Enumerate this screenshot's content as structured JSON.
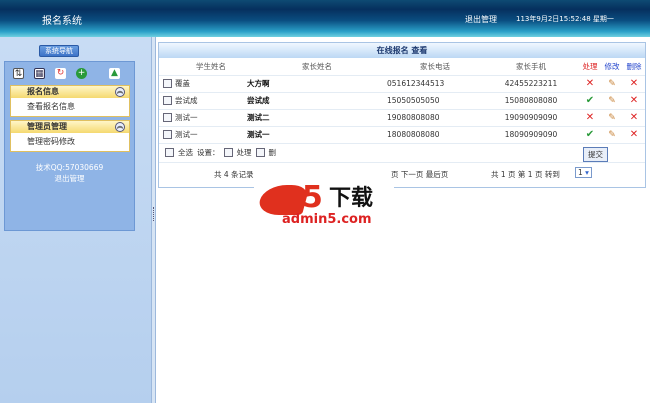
{
  "header": {
    "title": "报名系统",
    "logout": "退出管理",
    "datetime": "113年9月2日15:52:48 星期一"
  },
  "sidebar": {
    "nav_button": "系统导航",
    "tool_icons": [
      "user-list-icon",
      "calendar-icon",
      "refresh-icon",
      "add-icon",
      "upload-icon"
    ],
    "sections": [
      {
        "title": "报名信息",
        "items": [
          "查看报名信息"
        ]
      },
      {
        "title": "管理员管理",
        "items": [
          "管理密码修改"
        ]
      }
    ],
    "support": "技术QQ:57030669",
    "logout": "退出管理"
  },
  "main": {
    "caption": "在线报名 查看",
    "columns": [
      "学生姓名",
      "家长姓名",
      "家长电话",
      "家长手机",
      "处理",
      "修改",
      "删除"
    ],
    "column_colors": {
      "处理": "#dd2222",
      "修改": "#2244cc",
      "删除": "#2244cc"
    },
    "rows": [
      {
        "student": "覆盖",
        "parent": "大方啊",
        "phone": "051612344513",
        "mobile": "42455223211",
        "handled": false
      },
      {
        "student": "尝试成",
        "parent": "尝试成",
        "phone": "15050505050",
        "mobile": "15080808080",
        "handled": true
      },
      {
        "student": "测试一",
        "parent": "测试二",
        "phone": "19080808080",
        "mobile": "19090909090",
        "handled": false
      },
      {
        "student": "测试一",
        "parent": "测试一",
        "phone": "18080808080",
        "mobile": "18090909090",
        "handled": true
      }
    ],
    "select_all": "全选",
    "settings": "设置：",
    "opt_handle": "处理",
    "opt_delete": "删",
    "submit": "提交",
    "pager": {
      "total": "共 4 条记录",
      "nav": "页 下一页 最后页",
      "pages": "共 1 页 第 1 页 转到",
      "page_select": "1"
    }
  },
  "watermark": {
    "logo": "a5下载",
    "domain": "admin5.com"
  }
}
